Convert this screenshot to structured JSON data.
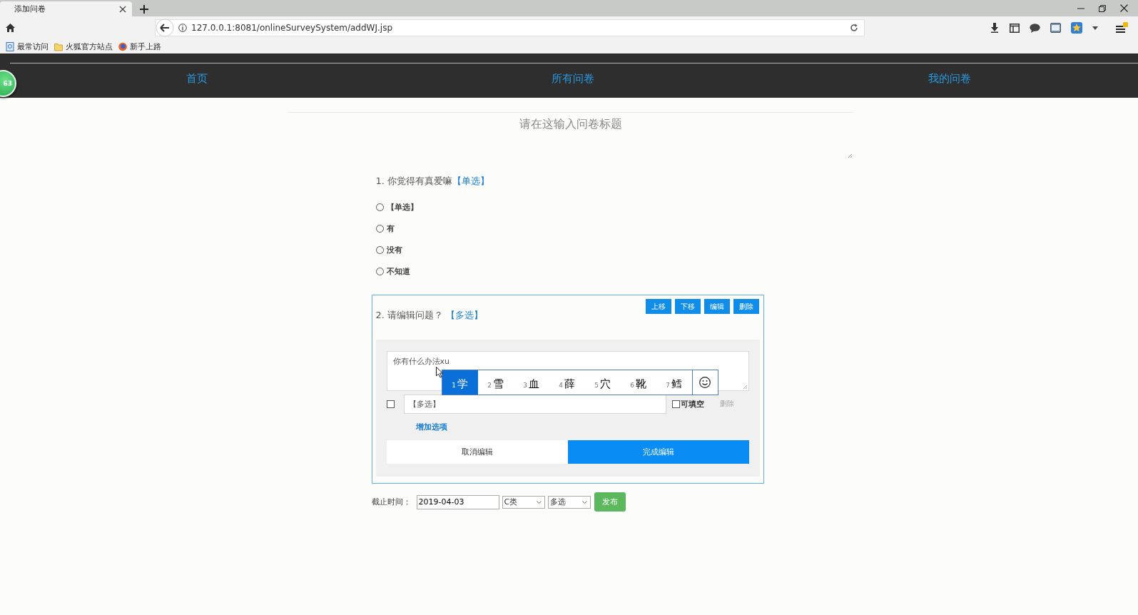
{
  "browser": {
    "tab_title": "添加问卷",
    "url": "127.0.0.1:8081/onlineSurveySystem/addWJ.jsp",
    "bookmarks": [
      "最常访问",
      "火狐官方站点",
      "新手上路"
    ]
  },
  "float_badge": "63",
  "nav": [
    {
      "label": "首页"
    },
    {
      "label": "所有问卷"
    },
    {
      "label": "我的问卷"
    }
  ],
  "title_field": {
    "placeholder": "请在这输入问卷标题"
  },
  "questions": [
    {
      "kind": "view",
      "number": "1.",
      "text": "你觉得有真爱嘛",
      "type_tag": "【单选】",
      "options": [
        {
          "label": "【单选】",
          "selected": false
        },
        {
          "label": "有",
          "selected": false
        },
        {
          "label": "没有",
          "selected": false
        },
        {
          "label": "不知道",
          "selected": false
        }
      ]
    },
    {
      "kind": "edit",
      "number": "2.",
      "text": "请编辑问题？",
      "type_tag": "【多选】",
      "actions": [
        "上移",
        "下移",
        "编辑",
        "删除"
      ],
      "question_input": {
        "value": "你有什么办法xu"
      },
      "ime_candidates": [
        {
          "index": "1",
          "char": "学",
          "selected": true
        },
        {
          "index": "2",
          "char": "雪",
          "selected": false
        },
        {
          "index": "3",
          "char": "血",
          "selected": false
        },
        {
          "index": "4",
          "char": "薛",
          "selected": false
        },
        {
          "index": "5",
          "char": "穴",
          "selected": false
        },
        {
          "index": "6",
          "char": "靴",
          "selected": false
        },
        {
          "index": "7",
          "char": "鳕",
          "selected": false
        }
      ],
      "option_rows": [
        {
          "checked": false,
          "value": "【多选】",
          "fillable_label": "可填空",
          "fillable": false,
          "delete": "删除"
        }
      ],
      "add_option": "增加选项",
      "cancel": "取消编辑",
      "done": "完成编辑"
    }
  ],
  "footer": {
    "deadline_label": "截止时间：",
    "deadline": "2019-04-03",
    "category": "C类",
    "type": "多选",
    "publish": "发布"
  }
}
